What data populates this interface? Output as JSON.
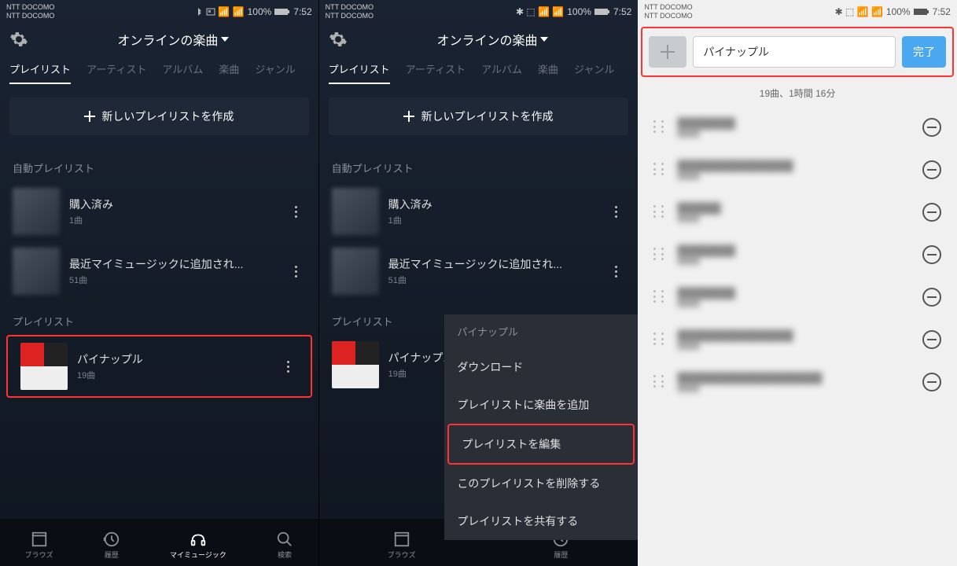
{
  "status": {
    "carrier": "NTT DOCOMO",
    "battery": "100%",
    "time": "7:52"
  },
  "header": {
    "title": "オンラインの楽曲"
  },
  "tabs": {
    "playlist": "プレイリスト",
    "artist": "アーティスト",
    "album": "アルバム",
    "song": "楽曲",
    "genre": "ジャンル"
  },
  "new_playlist": "新しいプレイリストを作成",
  "sections": {
    "auto": "自動プレイリスト",
    "playlist": "プレイリスト"
  },
  "items": {
    "purchased": {
      "title": "購入済み",
      "sub": "1曲"
    },
    "recent": {
      "title": "最近マイミュージックに追加され...",
      "sub": "51曲"
    },
    "pineapple": {
      "title": "パイナップル",
      "sub": "19曲"
    }
  },
  "nav": {
    "browse": "ブラウズ",
    "history": "履歴",
    "mymusic": "マイミュージック",
    "search": "検索"
  },
  "context": {
    "header": "パイナップル",
    "download": "ダウンロード",
    "add_songs": "プレイリストに楽曲を追加",
    "edit": "プレイリストを編集",
    "delete": "このプレイリストを削除する",
    "share": "プレイリストを共有する"
  },
  "panel3": {
    "input_value": "パイナップル",
    "done": "完了",
    "stats": "19曲、1時間 16分"
  }
}
